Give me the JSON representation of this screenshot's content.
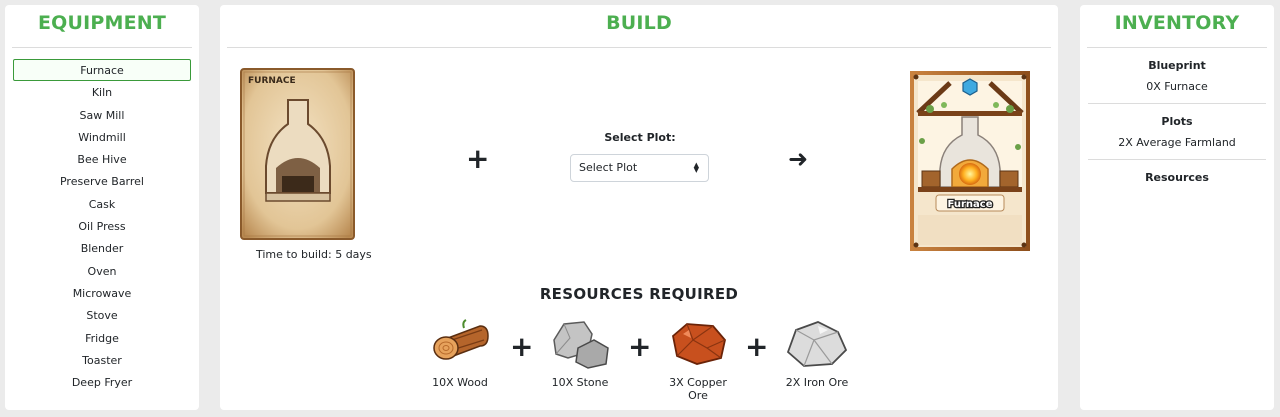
{
  "equipment": {
    "title": "EQUIPMENT",
    "items": [
      {
        "label": "Furnace",
        "selected": true
      },
      {
        "label": "Kiln"
      },
      {
        "label": "Saw Mill"
      },
      {
        "label": "Windmill"
      },
      {
        "label": "Bee Hive"
      },
      {
        "label": "Preserve Barrel"
      },
      {
        "label": "Cask"
      },
      {
        "label": "Oil Press"
      },
      {
        "label": "Blender"
      },
      {
        "label": "Oven"
      },
      {
        "label": "Microwave"
      },
      {
        "label": "Stove"
      },
      {
        "label": "Fridge"
      },
      {
        "label": "Toaster"
      },
      {
        "label": "Deep Fryer"
      }
    ]
  },
  "build": {
    "title": "BUILD",
    "blueprint_card_label": "FURNACE",
    "time_to_build": "Time to build: 5 days",
    "plus_symbol": "+",
    "arrow_symbol": "➜",
    "plot_label": "Select Plot:",
    "plot_selected": "Select Plot",
    "result_card_label": "Furnace",
    "resources_title": "RESOURCES REQUIRED",
    "resources": [
      {
        "label": "10X Wood",
        "icon": "wood-log-icon"
      },
      {
        "label": "10X Stone",
        "icon": "stone-icon"
      },
      {
        "label": "3X Copper Ore",
        "icon": "copper-ore-icon"
      },
      {
        "label": "2X Iron Ore",
        "icon": "iron-ore-icon"
      }
    ]
  },
  "inventory": {
    "title": "INVENTORY",
    "blueprint": {
      "title": "Blueprint",
      "value": "0X Furnace"
    },
    "plots": {
      "title": "Plots",
      "value": "2X Average Farmland"
    },
    "resources": {
      "title": "Resources"
    }
  },
  "colors": {
    "accent": "#4caf50",
    "selected_border": "#3a9a3a",
    "copper": "#c8501e",
    "wood": "#b5652b"
  }
}
